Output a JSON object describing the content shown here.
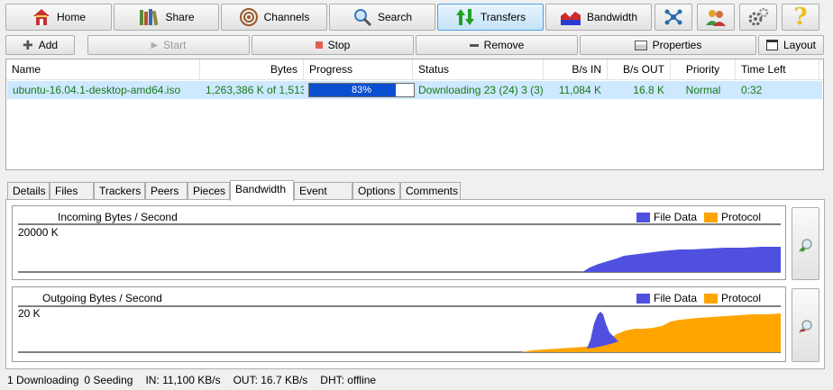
{
  "toolbar": {
    "home": "Home",
    "share": "Share",
    "channels": "Channels",
    "search": "Search",
    "transfers": "Transfers",
    "bandwidth": "Bandwidth"
  },
  "actions": {
    "add": "Add",
    "start": "Start",
    "stop": "Stop",
    "remove": "Remove",
    "properties": "Properties",
    "layout": "Layout"
  },
  "columns": {
    "name": "Name",
    "bytes": "Bytes",
    "progress": "Progress",
    "status": "Status",
    "bs_in": "B/s IN",
    "bs_out": "B/s OUT",
    "priority": "Priority",
    "time_left": "Time Left"
  },
  "transfer": {
    "name": "ubuntu-16.04.1-desktop-amd64.iso",
    "bytes": "1,263,386 K of 1,513,3",
    "progress": 0.83,
    "progress_text": "83%",
    "status": "Downloading 23 (24) 3 (3)",
    "bs_in": "11,084 K",
    "bs_out": "16.8 K",
    "priority": "Normal",
    "time_left": "0:32"
  },
  "tabs": {
    "details": "Details",
    "files": "Files",
    "trackers": "Trackers",
    "peers": "Peers",
    "pieces": "Pieces",
    "bandwidth": "Bandwidth",
    "event_log": "Event Log",
    "options": "Options",
    "comments": "Comments"
  },
  "graphs": {
    "file_data_color": "#5050e0",
    "protocol_color": "#ffa500",
    "incoming": {
      "title": "Incoming Bytes / Second",
      "scale": "20000 K",
      "legend_file": "File Data",
      "legend_protocol": "Protocol"
    },
    "outgoing": {
      "title": "Outgoing Bytes / Second",
      "scale": "20 K",
      "legend_file": "File Data",
      "legend_protocol": "Protocol"
    }
  },
  "status": {
    "downloading": "1 Downloading",
    "seeding": "0 Seeding",
    "in": "IN: 11,100 KB/s",
    "out": "OUT: 16.7 KB/s",
    "dht": "DHT: offline"
  }
}
